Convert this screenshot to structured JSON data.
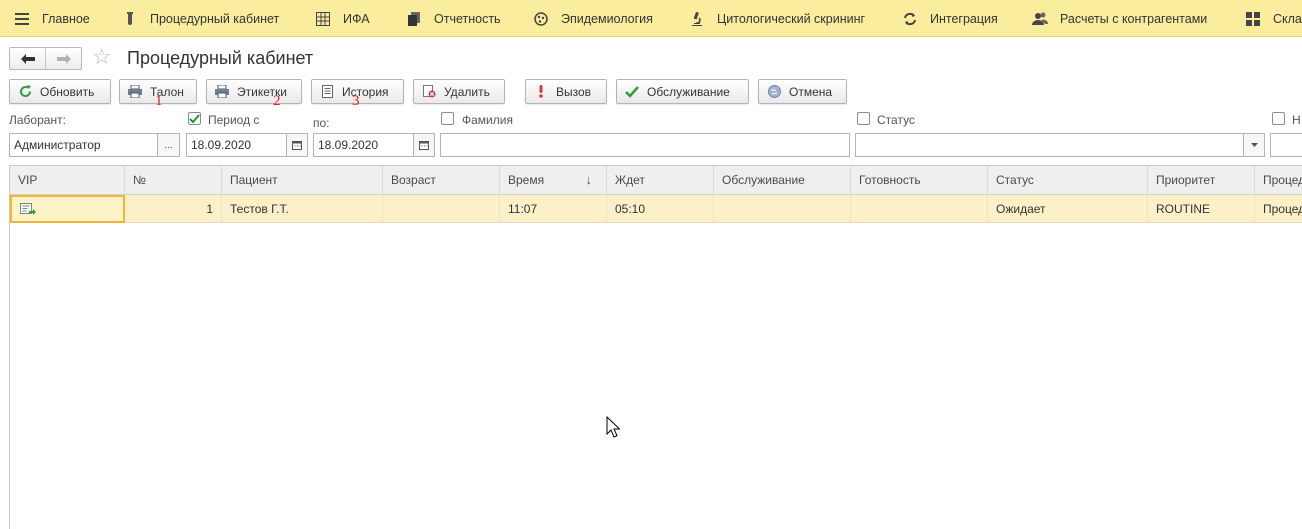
{
  "sections": [
    {
      "label": "Главное",
      "icon": "menu-icon"
    },
    {
      "label": "Процедурный кабинет",
      "icon": "test-tube-icon"
    },
    {
      "label": "ИФА",
      "icon": "grid-plate-icon"
    },
    {
      "label": "Отчетность",
      "icon": "reports-icon"
    },
    {
      "label": "Эпидемиология",
      "icon": "virus-icon"
    },
    {
      "label": "Цитологический скрининг",
      "icon": "microscope-icon"
    },
    {
      "label": "Интеграция",
      "icon": "sync-icon"
    },
    {
      "label": "Расчеты с контрагентами",
      "icon": "people-icon"
    },
    {
      "label": "Скла",
      "icon": "warehouse-icon"
    }
  ],
  "page": {
    "title": "Процедурный кабинет"
  },
  "toolbar": {
    "buttons": [
      {
        "label": "Обновить",
        "icon": "refresh-icon"
      },
      {
        "label": "Талон",
        "icon": "printer-icon"
      },
      {
        "label": "Этикетки",
        "icon": "printer-icon"
      },
      {
        "label": "История",
        "icon": "document-icon"
      },
      {
        "label": "Удалить",
        "icon": "delete-icon"
      },
      {
        "label": "Вызов",
        "icon": "exclamation-icon"
      },
      {
        "label": "Обслуживание",
        "icon": "checkmark-icon"
      },
      {
        "label": "Отмена",
        "icon": "globe-icon"
      }
    ],
    "annotations": [
      "1",
      "2",
      "3"
    ]
  },
  "filters": {
    "laborant_label": "Лаборант:",
    "laborant_value": "Администратор",
    "period_label": "Период с",
    "period_checked": true,
    "period_from": "18.09.2020",
    "to_label": "по:",
    "period_to": "18.09.2020",
    "surname_label": "Фамилия",
    "surname_checked": false,
    "surname_value": "",
    "status_label": "Статус",
    "status_checked": false,
    "status_value": "",
    "extra_label": "Н",
    "extra_checked": false,
    "picker_dots": "..."
  },
  "grid": {
    "columns": [
      "VIP",
      "№",
      "Пациент",
      "Возраст",
      "Время",
      "Ждет",
      "Обслуживание",
      "Готовность",
      "Статус",
      "Приоритет",
      "Процед"
    ],
    "sort_indicator": "↓",
    "rows": [
      {
        "vip_icon": "document-arrow-icon",
        "num": "1",
        "patient": "Тестов Г.Т.",
        "age": "",
        "time": "11:07",
        "waits": "05:10",
        "service": "",
        "ready": "",
        "status": "Ожидает",
        "priority": "ROUTINE",
        "procedure": "Процед"
      }
    ]
  },
  "colors": {
    "section_bar": "#fbed9e",
    "selected_row": "#fbf0c8",
    "selected_cell_border": "#f0b732",
    "annotation": "#e02020"
  }
}
